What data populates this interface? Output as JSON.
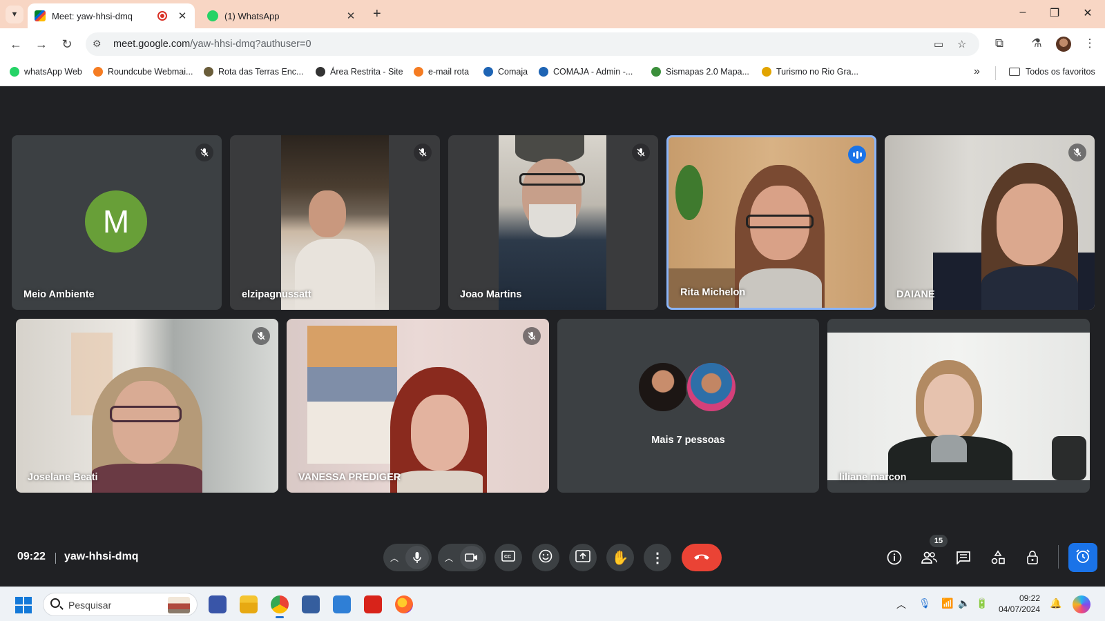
{
  "browser": {
    "tabs": [
      {
        "title": "Meet: yaw-hhsi-dmq",
        "active": true,
        "recording": true
      },
      {
        "title": "(1) WhatsApp",
        "active": false
      }
    ],
    "url_host": "meet.google.com",
    "url_path": "/yaw-hhsi-dmq?authuser=0",
    "bookmarks": [
      {
        "label": "whatsApp Web",
        "color": "#25d366"
      },
      {
        "label": "Roundcube Webmai...",
        "color": "#f57c22"
      },
      {
        "label": "Rota das Terras Enc...",
        "color": "#6a5d3a"
      },
      {
        "label": "Área Restrita - Site",
        "color": "#333333"
      },
      {
        "label": "e-mail rota",
        "color": "#f57c22"
      },
      {
        "label": "Comaja",
        "color": "#1e64b4"
      },
      {
        "label": "COMAJA - Admin -...",
        "color": "#1e64b4"
      },
      {
        "label": "Sismapas 2.0 Mapa...",
        "color": "#3b8f3b"
      },
      {
        "label": "Turismo no Rio Gra...",
        "color": "#e2a400"
      }
    ],
    "all_bookmarks": "Todos os favoritos"
  },
  "meet": {
    "participants": [
      {
        "name": "Meio Ambiente",
        "muted": true,
        "avatar_letter": "M"
      },
      {
        "name": "elzipagnussatt",
        "muted": true
      },
      {
        "name": "Joao Martins",
        "muted": true
      },
      {
        "name": "Rita Michelon",
        "muted": false,
        "speaking": true
      },
      {
        "name": "DAIANE",
        "muted": true
      },
      {
        "name": "Joselane Beati",
        "muted": true
      },
      {
        "name": "VANESSA PREDIGER",
        "muted": true
      },
      {
        "name": "liliane marcon",
        "muted": false
      }
    ],
    "more_people": "Mais 7 pessoas",
    "time": "09:22",
    "meeting_code": "yaw-hhsi-dmq",
    "participant_count": "15"
  },
  "taskbar": {
    "search_placeholder": "Pesquisar",
    "time": "09:22",
    "date": "04/07/2024"
  },
  "icons": [
    "mic-off-icon",
    "mic-icon",
    "camera-icon",
    "captions-icon",
    "emoji-icon",
    "present-icon",
    "raise-hand-icon",
    "more-options-icon",
    "hangup-icon",
    "info-icon",
    "people-icon",
    "chat-icon",
    "activities-icon",
    "host-controls-icon",
    "timer-icon"
  ]
}
